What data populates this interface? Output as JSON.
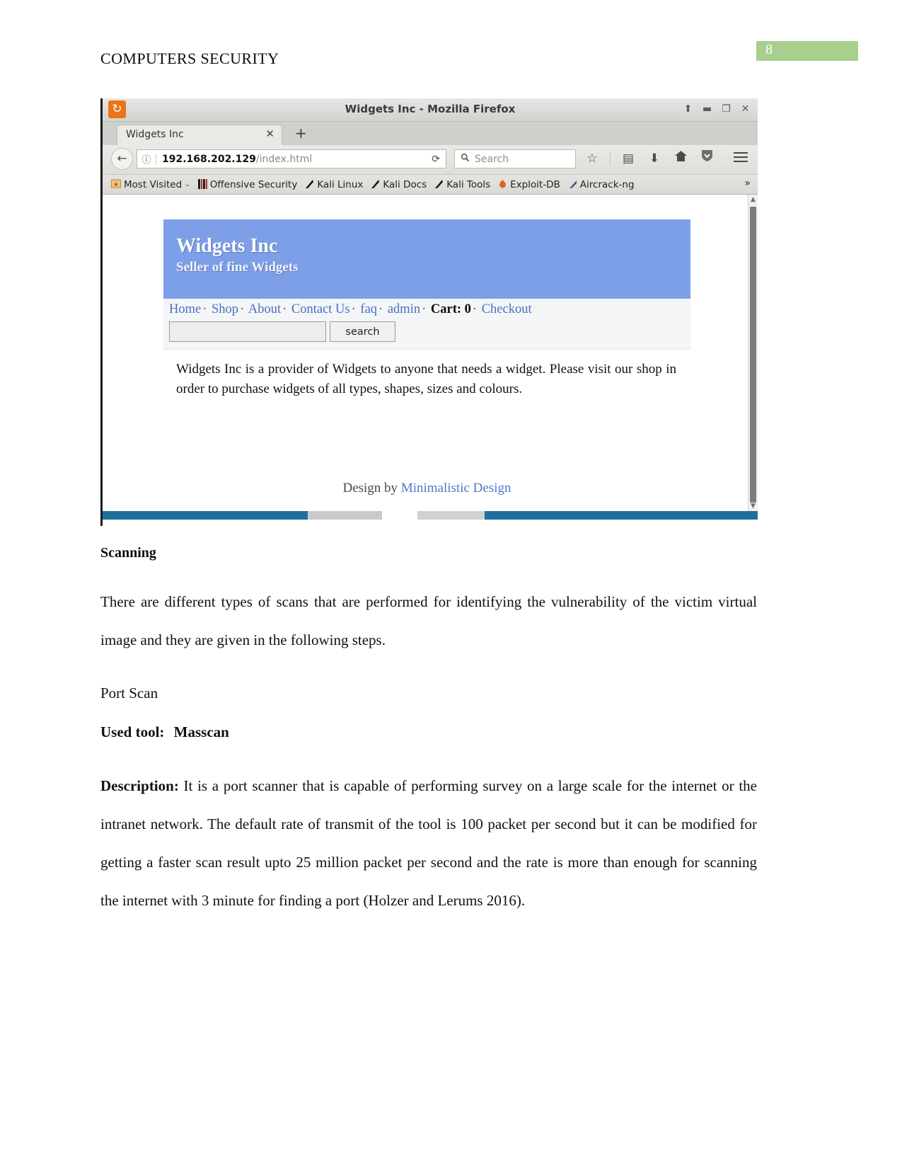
{
  "document": {
    "running_head": "COMPUTERS SECURITY",
    "page_number": "8",
    "page_number_bg": "#a9cf8f",
    "sections": {
      "scanning_heading": "Scanning",
      "scanning_para": "There are different types of scans that are performed for identifying the vulnerability of the victim virtual image and they are given in the following steps.",
      "port_scan_label": "Port Scan",
      "used_tool_label": "Used tool:",
      "used_tool_value": "Masscan",
      "description_label": "Description:",
      "description_text": "It is a port scanner that is capable of performing survey on a large scale for the internet or the intranet network. The default rate of transmit of the tool is 100 packet per second but it can be modified for getting a faster scan result upto 25 million packet per second and the rate is more than enough for scanning the internet with 3 minute for finding a port (Holzer and Lerums 2016)."
    }
  },
  "browser": {
    "window_title": "Widgets Inc - Mozilla Firefox",
    "logo_glyph": "↻",
    "window_controls": [
      {
        "name": "shade-button",
        "glyph": "⬆"
      },
      {
        "name": "minimize-button",
        "glyph": "▬"
      },
      {
        "name": "maximize-button",
        "glyph": "❐"
      },
      {
        "name": "close-button",
        "glyph": "✕"
      }
    ],
    "tab": {
      "label": "Widgets Inc",
      "close_glyph": "✕",
      "new_tab_glyph": "+"
    },
    "toolbar": {
      "back_glyph": "←",
      "info_glyph": "ⓘ",
      "url_host": "192.168.202.129",
      "url_path": "/index.html",
      "reload_glyph": "⟳",
      "search_placeholder": "Search",
      "search_icon": "🔍",
      "icons": [
        {
          "name": "bookmark-star-icon",
          "glyph": "☆"
        },
        {
          "name": "reader-view-icon",
          "glyph": "▤"
        },
        {
          "name": "downloads-icon",
          "glyph": "⬇"
        },
        {
          "name": "home-icon",
          "glyph": "⌂"
        },
        {
          "name": "shield-icon",
          "glyph": "🛡"
        }
      ]
    },
    "bookmarks": [
      {
        "label": "Most Visited",
        "icon": "folder-star-icon",
        "glyph": "▤",
        "color": "#e08a2e",
        "caret": "⌄"
      },
      {
        "label": "Offensive Security",
        "icon": "offensive-security-icon",
        "glyph": "▮▮",
        "color": "#b5332f",
        "caret": ""
      },
      {
        "label": "Kali Linux",
        "icon": "kali-dragon-icon",
        "glyph": "✎",
        "color": "#1b1b1b",
        "caret": ""
      },
      {
        "label": "Kali Docs",
        "icon": "kali-dragon-icon",
        "glyph": "✎",
        "color": "#1b1b1b",
        "caret": ""
      },
      {
        "label": "Kali Tools",
        "icon": "kali-dragon-icon",
        "glyph": "✎",
        "color": "#1b1b1b",
        "caret": ""
      },
      {
        "label": "Exploit-DB",
        "icon": "exploit-db-icon",
        "glyph": "◣",
        "color": "#e2621c",
        "caret": ""
      },
      {
        "label": "Aircrack-ng",
        "icon": "aircrack-icon",
        "glyph": "◥",
        "color": "#3d5a77",
        "caret": ""
      }
    ],
    "bookmarks_overflow_glyph": "»",
    "scrollbar": {
      "up_glyph": "▲",
      "down_glyph": "▼"
    }
  },
  "page": {
    "banner": {
      "title": "Widgets Inc",
      "subtitle": "Seller of fine Widgets",
      "bg_color": "#7d9fe8"
    },
    "nav": {
      "links": [
        "Home",
        "Shop",
        "About",
        "Contact Us",
        "faq",
        "admin"
      ],
      "separator": "·",
      "cart_label": "Cart: 0",
      "checkout_label": "Checkout",
      "link_color": "#4a6fc4"
    },
    "search": {
      "value": "",
      "placeholder": "",
      "button_label": "search"
    },
    "body_text": "Widgets Inc is a provider of Widgets to anyone that needs a widget. Please visit our shop in order to purchase widgets of all types, shapes, sizes and colours.",
    "footer": {
      "prefix": "Design by ",
      "link_label": "Minimalistic Design"
    }
  }
}
